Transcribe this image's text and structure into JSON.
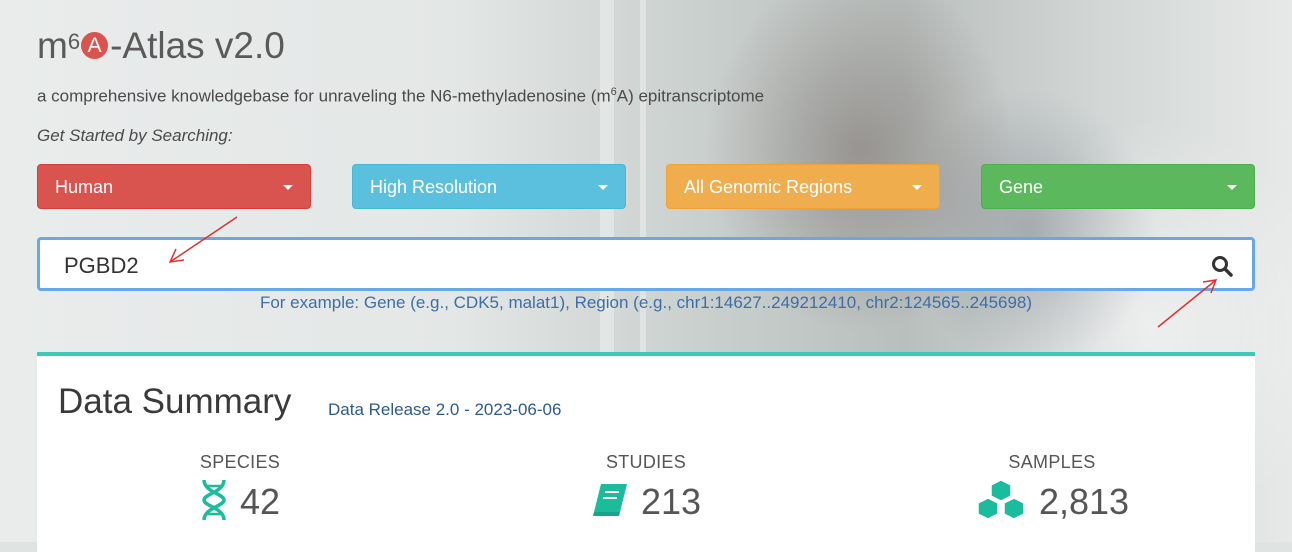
{
  "header": {
    "title_prefix": "m",
    "title_superscript": "6",
    "title_badge": "A",
    "title_suffix": "-Atlas v2.0",
    "subtitle_prefix": "a comprehensive knowledgebase for unraveling the N6-methyladenosine (m",
    "subtitle_superscript": "6",
    "subtitle_suffix": "A) epitranscriptome",
    "get_started": "Get Started by Searching:"
  },
  "filters": [
    {
      "label": "Human",
      "color": "#d9534f"
    },
    {
      "label": "High Resolution",
      "color": "#5bc0de"
    },
    {
      "label": "All Genomic Regions",
      "color": "#f0ad4e"
    },
    {
      "label": "Gene",
      "color": "#5cb85c"
    }
  ],
  "search": {
    "value": "PGBD2",
    "example": "For example: Gene (e.g., CDK5, malat1), Region (e.g., chr1:14627..249212410, chr2:124565..245698)",
    "icon": "search-icon"
  },
  "summary": {
    "title": "Data Summary",
    "release": "Data Release 2.0 - 2023-06-06",
    "accent_color": "#1abc9c",
    "stats": [
      {
        "label": "SPECIES",
        "value": "42",
        "icon": "dna-icon"
      },
      {
        "label": "STUDIES",
        "value": "213",
        "icon": "book-icon"
      },
      {
        "label": "SAMPLES",
        "value": "2,813",
        "icon": "cubes-icon"
      }
    ]
  }
}
